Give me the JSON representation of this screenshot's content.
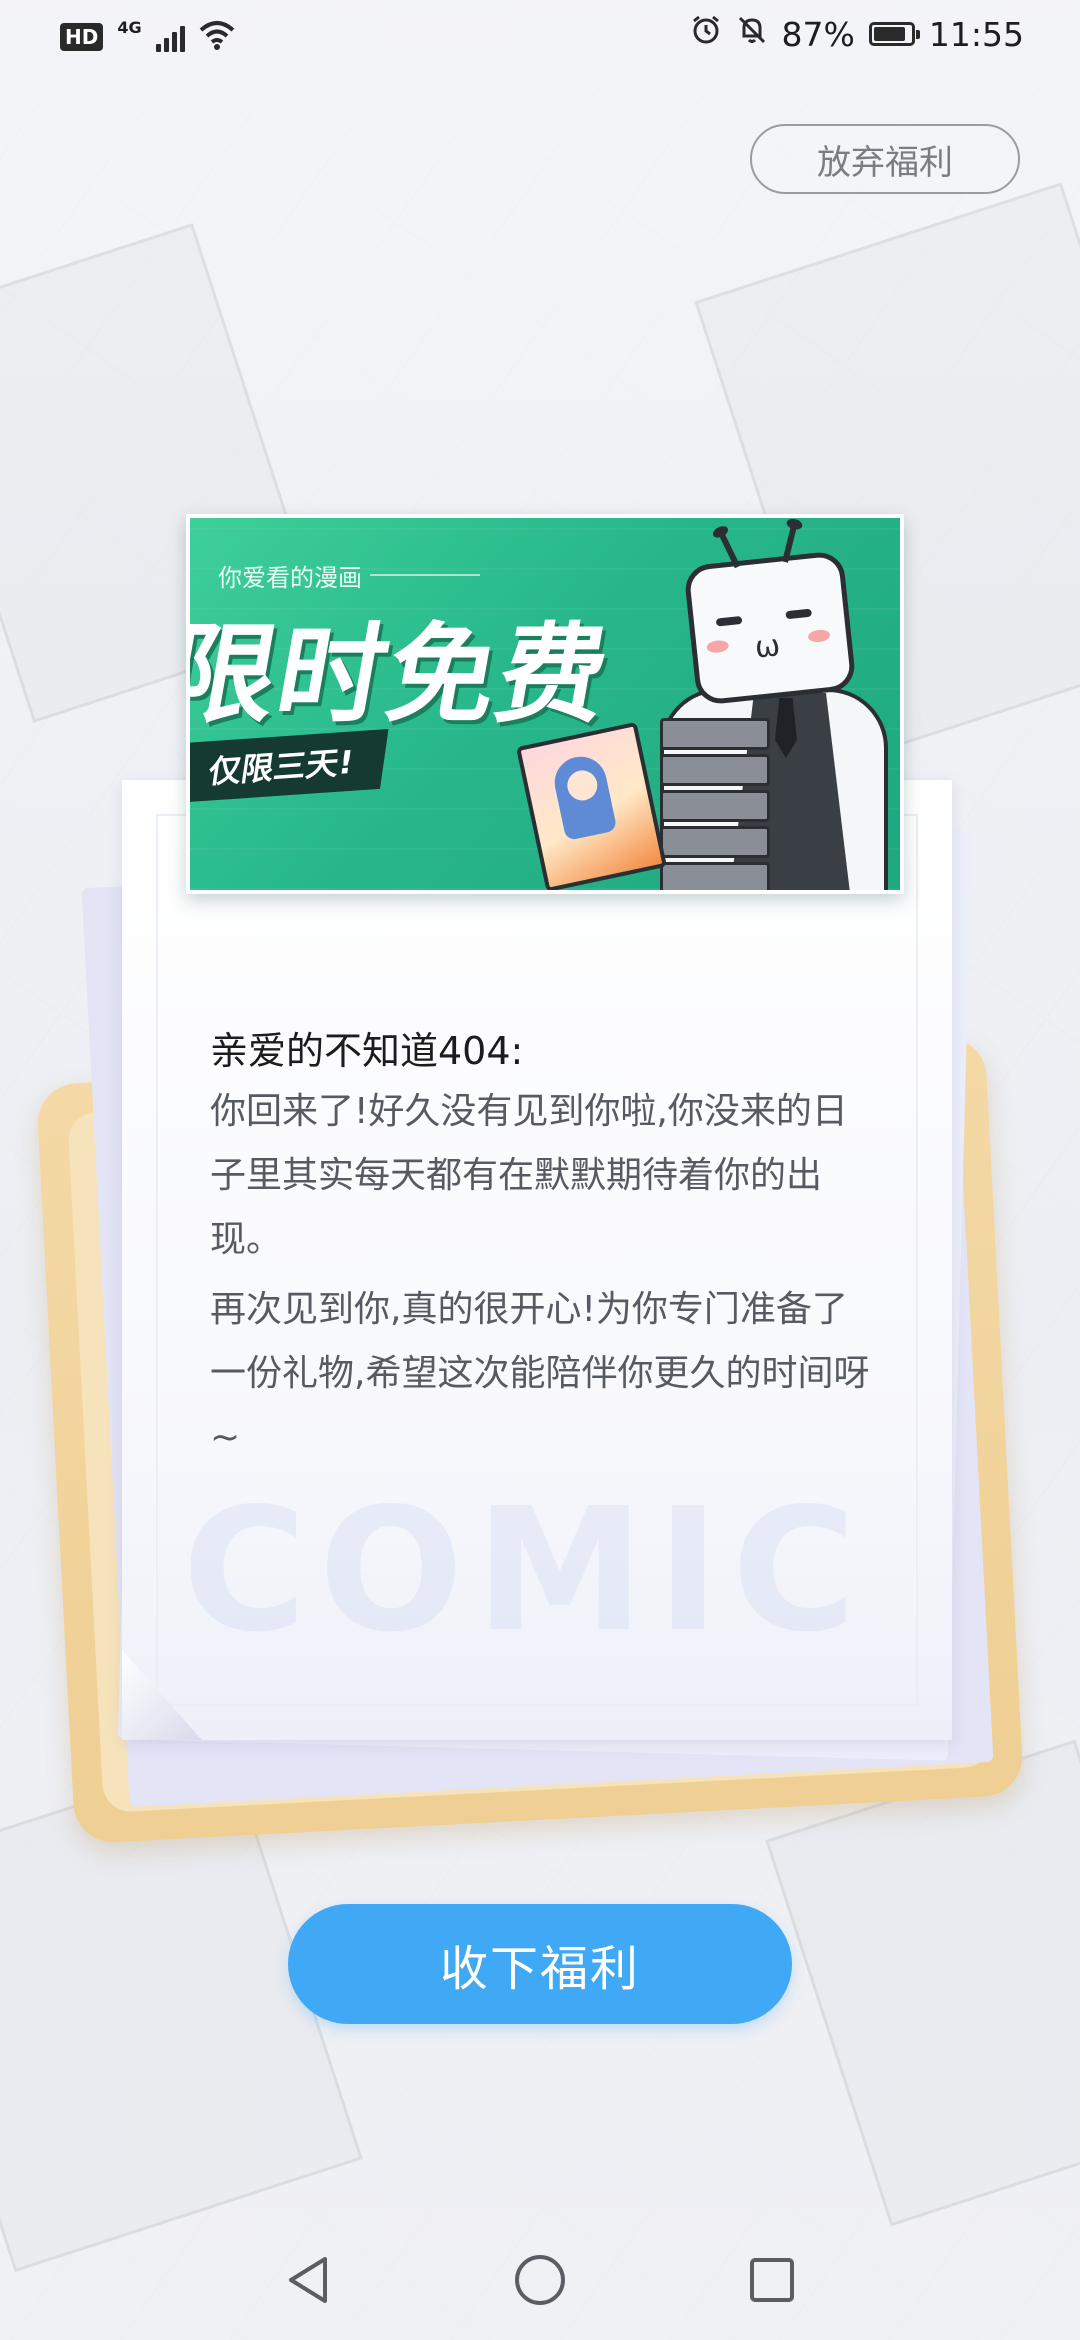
{
  "status_bar": {
    "hd_label": "HD",
    "network_label": "4G",
    "battery_percent": "87%",
    "battery_level": 0.87,
    "time": "11:55",
    "icons": [
      "wifi-icon",
      "alarm-icon",
      "mute-icon",
      "battery-icon"
    ]
  },
  "header": {
    "giveup_label": "放弃福利"
  },
  "banner": {
    "subtitle": "你爱看的漫画",
    "title": "限时免费",
    "tag": "仅限三天!"
  },
  "letter": {
    "greeting": "亲爱的不知道404:",
    "paragraphs": [
      "你回来了!好久没有见到你啦,你没来的日子里其实每天都有在默默期待着你的出现。",
      "再次见到你,真的很开心!为你专门准备了一份礼物,希望这次能陪伴你更久的时间呀~"
    ],
    "watermark": "COMIC"
  },
  "actions": {
    "accept_label": "收下福利"
  },
  "nav": {
    "icons": [
      "back-triangle-icon",
      "home-circle-icon",
      "recents-square-icon"
    ]
  },
  "colors": {
    "accent_blue": "#3fa9f5",
    "banner_green": "#27b78a",
    "envelope": "#f4d9a6"
  }
}
